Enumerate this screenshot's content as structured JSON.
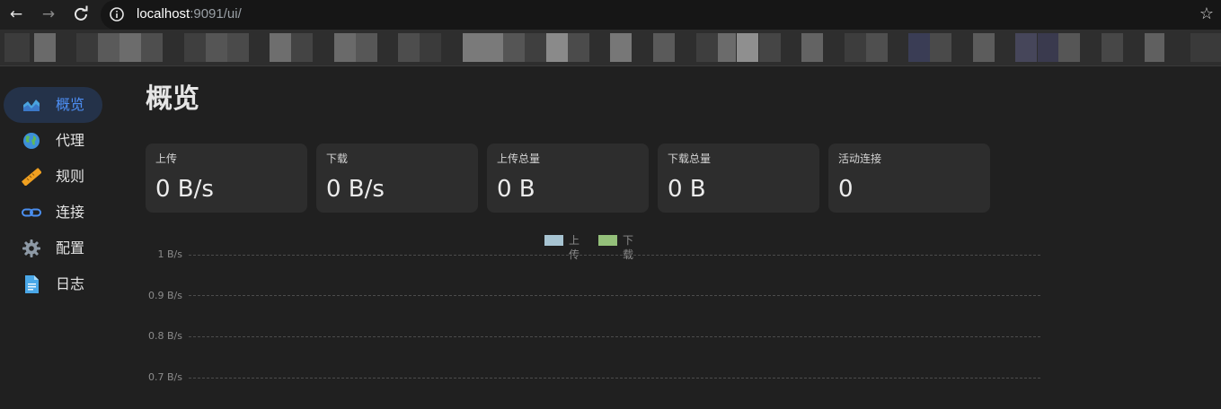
{
  "browser": {
    "url_host": "localhost",
    "url_rest": ":9091/ui/",
    "icons": {
      "back": "arrow-left-icon",
      "forward": "arrow-right-icon",
      "reload": "reload-icon",
      "site_info": "info-icon",
      "bookmark": "star-icon"
    }
  },
  "sidebar": {
    "items": [
      {
        "label": "概览",
        "icon": "area-chart-icon",
        "active": true
      },
      {
        "label": "代理",
        "icon": "globe-icon",
        "active": false
      },
      {
        "label": "规则",
        "icon": "ruler-icon",
        "active": false
      },
      {
        "label": "连接",
        "icon": "link-icon",
        "active": false
      },
      {
        "label": "配置",
        "icon": "gear-icon",
        "active": false
      },
      {
        "label": "日志",
        "icon": "document-icon",
        "active": false
      }
    ]
  },
  "main": {
    "title": "概览",
    "stats": [
      {
        "label": "上传",
        "value": "0 B/s"
      },
      {
        "label": "下载",
        "value": "0 B/s"
      },
      {
        "label": "上传总量",
        "value": "0 B"
      },
      {
        "label": "下载总量",
        "value": "0 B"
      },
      {
        "label": "活动连接",
        "value": "0"
      }
    ]
  },
  "chart_data": {
    "type": "area",
    "series": [
      {
        "name": "上传",
        "color": "#a7c4d2",
        "values": []
      },
      {
        "name": "下载",
        "color": "#94c07a",
        "values": []
      }
    ],
    "y_ticks": [
      "1 B/s",
      "0.9 B/s",
      "0.8 B/s",
      "0.7 B/s"
    ],
    "ylim": [
      0,
      1
    ],
    "grid": true,
    "legend_position": "top-center"
  },
  "colors": {
    "background": "#202020",
    "card": "#2d2d2d",
    "active_nav_bg": "#243249",
    "accent": "#4d8ff5"
  }
}
